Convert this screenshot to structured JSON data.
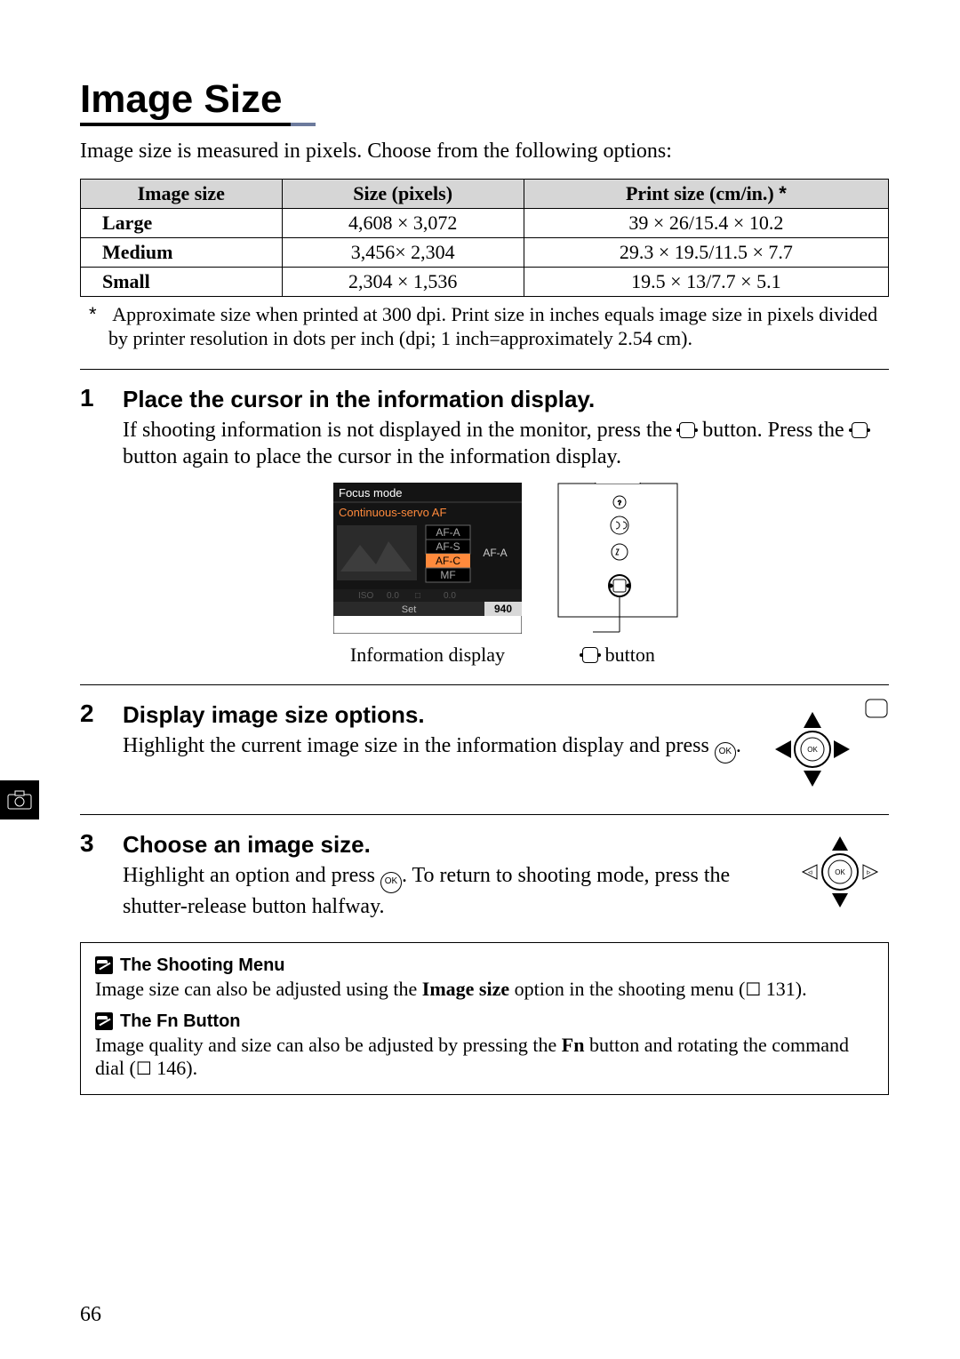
{
  "heading": "Image Size",
  "intro": "Image size is measured in pixels.  Choose from the following options:",
  "table": {
    "headers": [
      "Image size",
      "Size (pixels)",
      "Print size (cm/in.)"
    ],
    "footnote_marker": "*",
    "rows": [
      [
        "Large",
        "4,608 × 3,072",
        "39 × 26/15.4 × 10.2"
      ],
      [
        "Medium",
        "3,456× 2,304",
        "29.3 × 19.5/11.5 × 7.7"
      ],
      [
        "Small",
        "2,304 × 1,536",
        "19.5 × 13/7.7 × 5.1"
      ]
    ]
  },
  "footnote": "Approximate size when printed at 300 dpi.  Print size in inches equals image size in pixels divided by printer resolution in dots per inch (dpi; 1 inch=approximately 2.54 cm).",
  "steps": {
    "s1": {
      "num": "1",
      "title": "Place the cursor in the information display.",
      "body_a": "If shooting information is not displayed in the monitor, press the ",
      "body_b": " button. Press the ",
      "body_c": " button again to place the cursor in the information display.",
      "info_lcd": {
        "line1": "Focus mode",
        "line2": "Continuous-servo AF",
        "opts": [
          "AF-A",
          "AF-S",
          "AF-C",
          "MF"
        ],
        "right": "AF-A",
        "footer_left": "Set",
        "footer_right": "940"
      },
      "caption_left": "Information display",
      "caption_right": "button"
    },
    "s2": {
      "num": "2",
      "title": "Display image size options.",
      "body_a": "Highlight the current image size in the information display and press ",
      "body_b": ".",
      "ok_label": "OK"
    },
    "s3": {
      "num": "3",
      "title": "Choose an image size.",
      "body_a": "Highlight an option and press ",
      "body_b": ".  To return to shooting mode, press the shutter-release button halfway.",
      "ok_label": "OK"
    }
  },
  "notes": {
    "n1": {
      "title": "The Shooting Menu",
      "body_a": "Image size can also be adjusted using the ",
      "bold": "Image size",
      "body_b": " option in the shooting menu (",
      "pageref": "131",
      "body_c": ")."
    },
    "n2": {
      "title": "The Fn Button",
      "body_a": "Image quality and size can also be adjusted by pressing the ",
      "bold": "Fn",
      "body_b": " button and rotating the command dial (",
      "pageref": "146",
      "body_c": ")."
    }
  },
  "pagenum": "66"
}
